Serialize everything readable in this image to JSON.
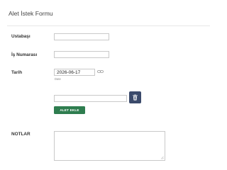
{
  "form": {
    "title": "Alet İstek Formu"
  },
  "fields": {
    "ustabasi": {
      "label": "Ustabaşı",
      "value": ""
    },
    "is_numarasi": {
      "label": "İş Numarası",
      "value": ""
    },
    "tarih": {
      "label": "Tarih",
      "value": "2026-06-17",
      "help": "Date"
    },
    "notlar": {
      "label": "NOTLAR",
      "value": ""
    }
  },
  "tools": {
    "row_value": "",
    "add_button_label": "ALET EKLE"
  },
  "colors": {
    "delete_button": "#3b4a6b",
    "add_button": "#2e7d4f"
  },
  "icons": {
    "delete": "trash-icon",
    "date_link": "link-icon"
  }
}
